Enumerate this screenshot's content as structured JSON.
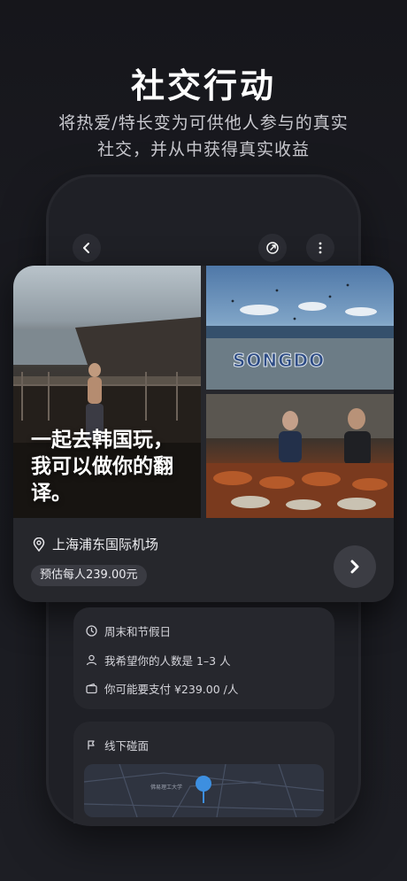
{
  "hero": {
    "title": "社交行动",
    "subtitle_line1": "将热爱/特长变为可供他人参与的真实",
    "subtitle_line2": "社交，并从中获得真实收益"
  },
  "phone_header": {
    "back_icon": "chevron-left-icon",
    "share_icon": "share-icon",
    "more_icon": "more-vertical-icon"
  },
  "activity_card": {
    "caption_line1": "一起去韩国玩，",
    "caption_line2": "我可以做你的翻",
    "caption_line3": "译。",
    "photo_sign": "SONGDO",
    "location": "上海浦东国际机场",
    "price": "预估每人239.00元"
  },
  "info": {
    "time": "周末和节假日",
    "people": "我希望你的人数是 1–3 人",
    "payment": "你可能要支付 ¥239.00 /人"
  },
  "meeting": {
    "label": "线下碰面",
    "map_label": "佛易理工大学"
  },
  "colors": {
    "background": "#1b1c22",
    "card": "#26272c",
    "map_pin": "#3d8fe0"
  }
}
